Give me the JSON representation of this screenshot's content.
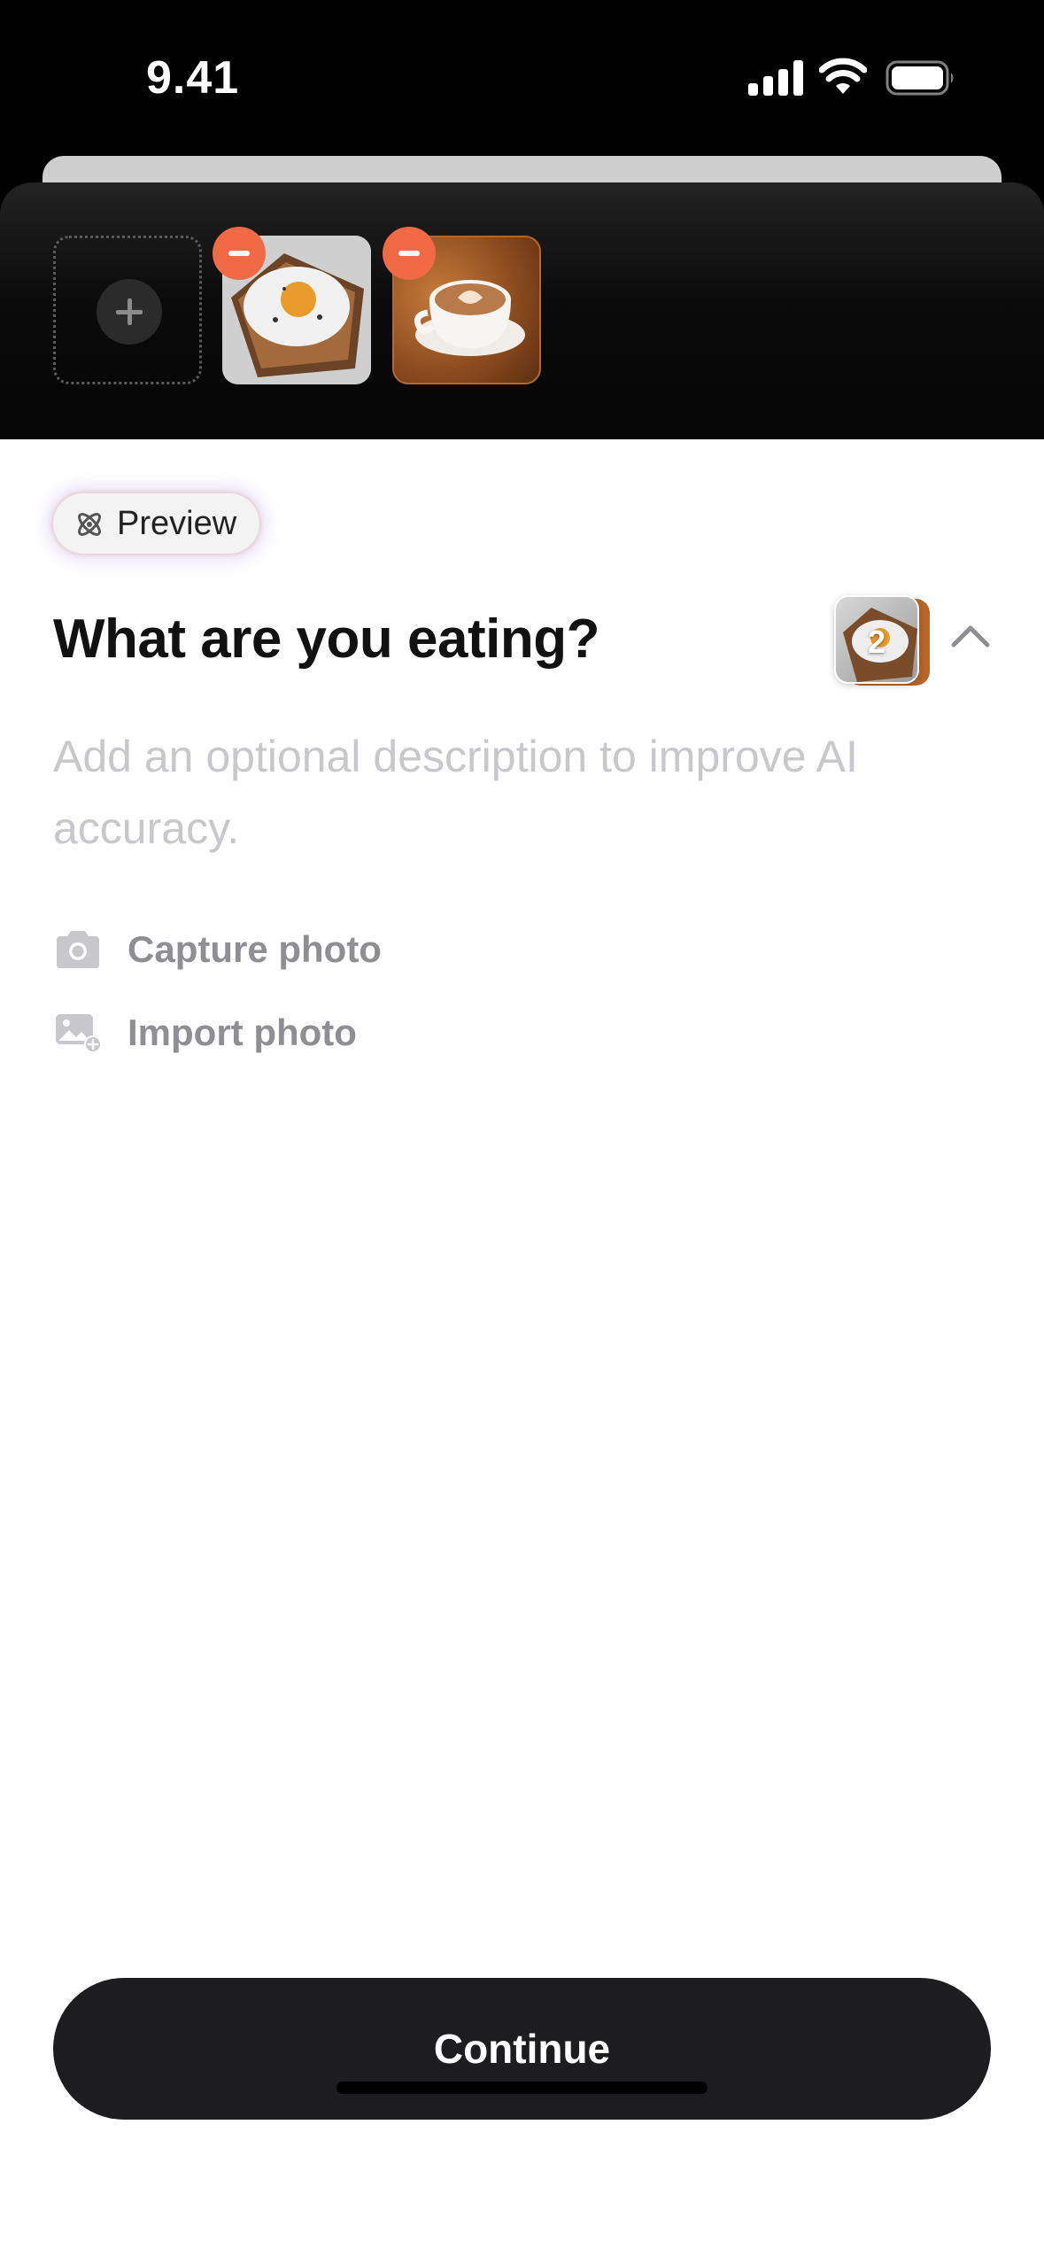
{
  "status_bar": {
    "time": "9.41",
    "icons": [
      "cellular-signal-icon",
      "wifi-icon",
      "battery-icon"
    ]
  },
  "media_strip": {
    "add_slot_icon": "plus-icon",
    "photos": [
      {
        "name": "fried-egg-toast-photo",
        "remove_icon": "minus-icon"
      },
      {
        "name": "latte-coffee-photo",
        "remove_icon": "minus-icon"
      }
    ]
  },
  "preview_badge": {
    "label": "Preview",
    "icon": "atom-icon"
  },
  "question": {
    "title": "What are you eating?",
    "photo_stack_count": "2",
    "collapse_icon": "chevron-up-icon"
  },
  "description": {
    "placeholder": "Add an optional description to improve AI accuracy."
  },
  "actions": [
    {
      "label": "Capture photo",
      "icon": "camera-icon"
    },
    {
      "label": "Import photo",
      "icon": "image-add-icon"
    }
  ],
  "footer": {
    "continue_label": "Continue"
  },
  "colors": {
    "accent_remove": "#f06b45",
    "button_bg": "#1d1d1f",
    "placeholder_text": "#c8c8cc",
    "secondary_text": "#8e8e93"
  }
}
